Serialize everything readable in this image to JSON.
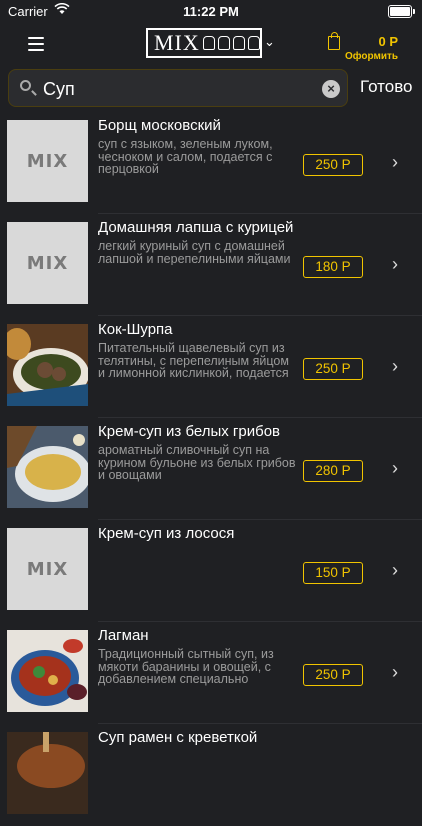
{
  "status_bar": {
    "carrier": "Carrier",
    "time": "11:22 PM"
  },
  "nav": {
    "logo_text": "MIX",
    "cart_total": "0 Р",
    "checkout_label": "Оформить"
  },
  "search": {
    "value": "Суп",
    "done_label": "Готово"
  },
  "placeholder_logo": "MIX",
  "items": [
    {
      "title": "Борщ московский",
      "description": "суп с языком, зеленым луком, чесноком и салом, подается с перцовкой",
      "price": "250 Р",
      "image": "placeholder"
    },
    {
      "title": "Домашняя лапша с курицей",
      "description": "легкий куриный суп с домашней лапшой и перепелиными яйцами",
      "price": "180 Р",
      "image": "placeholder"
    },
    {
      "title": "Кок-Шурпа",
      "description": "Питательный щавелевый суп из телятины, с перепелиным яйцом и лимонной кислинкой, подается со сметаной",
      "price": "250 Р",
      "image": "photo"
    },
    {
      "title": "Крем-суп из белых грибов",
      "description": "ароматный сливочный суп на курином бульоне из белых грибов и овощами",
      "price": "280 Р",
      "image": "photo"
    },
    {
      "title": "Крем-суп из лосося",
      "description": "",
      "price": "150 Р",
      "image": "placeholder"
    },
    {
      "title": "Лагман",
      "description": "Традиционный сытный суп, из мякоти баранины и овощей, с добавлением специально приготовленной лапши",
      "price": "250 Р",
      "image": "photo"
    },
    {
      "title": "Суп рамен с креветкой",
      "description": "",
      "price": "",
      "image": "photo"
    }
  ]
}
